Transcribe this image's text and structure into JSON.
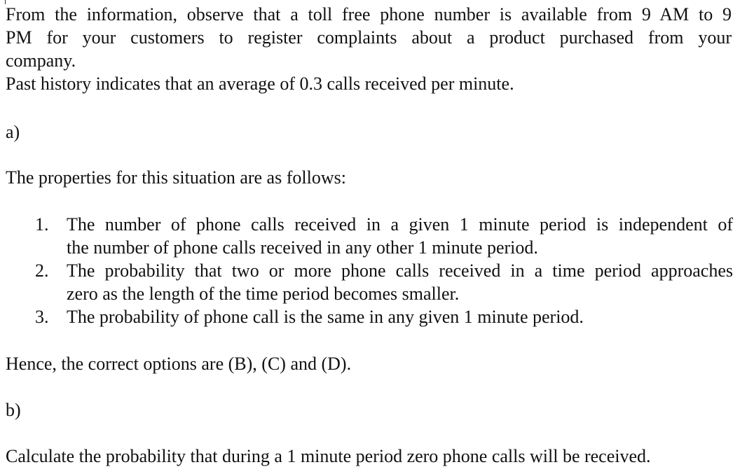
{
  "intro": {
    "line1": "From the information, observe that a toll free phone number is available from 9 AM to 9",
    "line2": "PM for your customers to register complaints about a product purchased from your",
    "line3": "company.",
    "line4": "Past history indicates that an average of 0.3 calls received per minute."
  },
  "part_a": {
    "label": "a)",
    "heading": "The properties for this situation are as follows:",
    "properties": [
      {
        "number": "1.",
        "lines": [
          "The number of phone calls received in a given 1 minute period is independent of",
          "the number of phone calls received in any other 1 minute period."
        ]
      },
      {
        "number": "2.",
        "lines": [
          "The probability that two or more phone calls received in a time period approaches",
          "zero as the length of the time period becomes smaller."
        ]
      },
      {
        "number": "3.",
        "lines": [
          "The probability of phone call is the same in any given 1 minute period."
        ]
      }
    ],
    "conclusion": "Hence, the correct options are (B), (C) and (D)."
  },
  "part_b": {
    "label": "b)",
    "question": "Calculate the probability that during a 1 minute period zero phone calls will be received."
  }
}
